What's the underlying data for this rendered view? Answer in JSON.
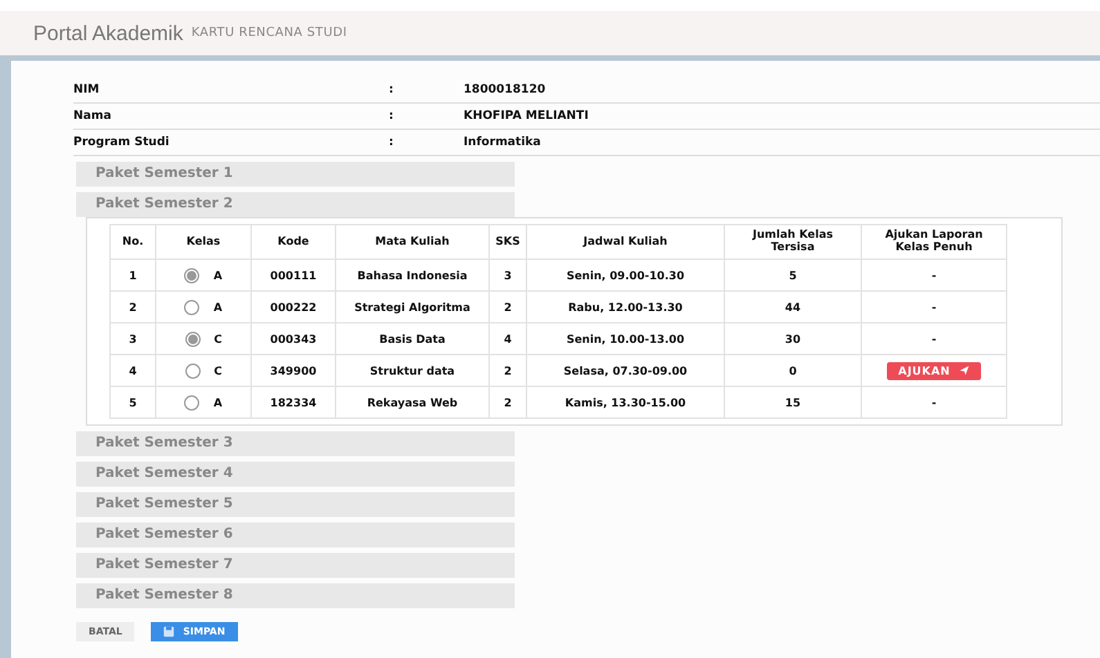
{
  "header": {
    "title": "Portal Akademik",
    "subtitle": "KARTU RENCANA STUDI"
  },
  "info": [
    {
      "label": "NIM",
      "separator": ":",
      "value": "1800018120"
    },
    {
      "label": "Nama",
      "separator": ":",
      "value": "KHOFIPA MELIANTI"
    },
    {
      "label": "Program Studi",
      "separator": ":",
      "value": "Informatika"
    }
  ],
  "packages": [
    {
      "label": "Paket Semester 1"
    },
    {
      "label": "Paket Semester 2",
      "table": {
        "columns": [
          "No.",
          "Kelas",
          "Kode",
          "Mata Kuliah",
          "SKS",
          "Jadwal Kuliah",
          "Jumlah Kelas Tersisa",
          "Ajukan Laporan Kelas Penuh"
        ],
        "rows": [
          {
            "no": "1",
            "selected": true,
            "kelas": "A",
            "kode": "000111",
            "mata_kuliah": "Bahasa Indonesia",
            "sks": "3",
            "jadwal": "Senin, 09.00-10.30",
            "sisa": "5",
            "ajukan": {
              "kind": "dash",
              "text": "-"
            }
          },
          {
            "no": "2",
            "selected": false,
            "kelas": "A",
            "kode": "000222",
            "mata_kuliah": "Strategi Algoritma",
            "sks": "2",
            "jadwal": "Rabu, 12.00-13.30",
            "sisa": "44",
            "ajukan": {
              "kind": "dash",
              "text": "-"
            }
          },
          {
            "no": "3",
            "selected": true,
            "kelas": "C",
            "kode": "000343",
            "mata_kuliah": "Basis Data",
            "sks": "4",
            "jadwal": "Senin, 10.00-13.00",
            "sisa": "30",
            "ajukan": {
              "kind": "dash",
              "text": "-"
            }
          },
          {
            "no": "4",
            "selected": false,
            "kelas": "C",
            "kode": "349900",
            "mata_kuliah": "Struktur data",
            "sks": "2",
            "jadwal": "Selasa, 07.30-09.00",
            "sisa": "0",
            "ajukan": {
              "kind": "button",
              "text": "AJUKAN"
            }
          },
          {
            "no": "5",
            "selected": false,
            "kelas": "A",
            "kode": "182334",
            "mata_kuliah": "Rekayasa Web",
            "sks": "2",
            "jadwal": "Kamis, 13.30-15.00",
            "sisa": "15",
            "ajukan": {
              "kind": "dash",
              "text": "-"
            }
          }
        ]
      }
    },
    {
      "label": "Paket Semester 3"
    },
    {
      "label": "Paket Semester 4"
    },
    {
      "label": "Paket Semester 5"
    },
    {
      "label": "Paket Semester 6"
    },
    {
      "label": "Paket Semester 7"
    },
    {
      "label": "Paket Semester 8"
    }
  ],
  "buttons": {
    "cancel": "BATAL",
    "save": "SIMPAN"
  }
}
